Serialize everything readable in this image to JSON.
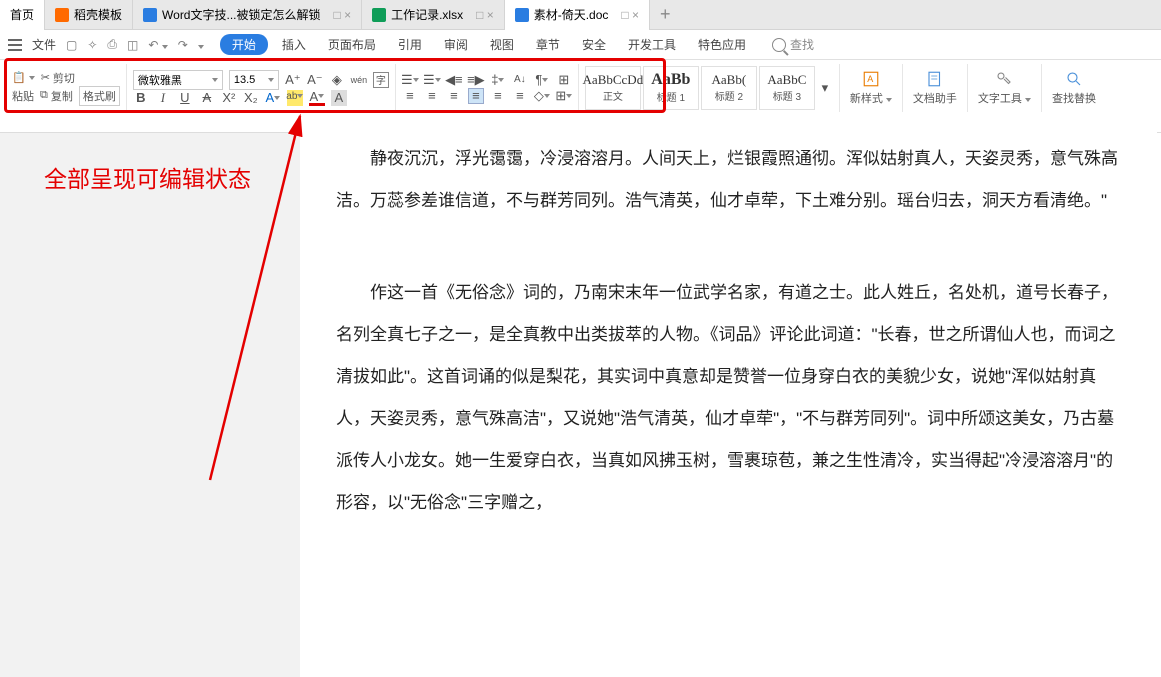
{
  "tabs": [
    {
      "label": "首页",
      "icon": "#2a7de1",
      "active": true
    },
    {
      "label": "稻壳模板",
      "icon": "#ff6a00"
    },
    {
      "label": "Word文字技...被锁定怎么解锁",
      "icon": "#2a7de1",
      "ctl": "□ ×"
    },
    {
      "label": "工作记录.xlsx",
      "icon": "#0f9d58",
      "ctl": "□ ×"
    },
    {
      "label": "素材-倚天.doc",
      "icon": "#2a7de1",
      "ctl": "□ ×"
    }
  ],
  "qat": {
    "file": "文件"
  },
  "menu": [
    "开始",
    "插入",
    "页面布局",
    "引用",
    "审阅",
    "视图",
    "章节",
    "安全",
    "开发工具",
    "特色应用"
  ],
  "search": "查找",
  "clipboard": {
    "paste": "粘贴",
    "cut": "剪切",
    "copy": "复制",
    "painter": "格式刷"
  },
  "font": {
    "name": "微软雅黑",
    "size": "13.5"
  },
  "icons": {
    "incfont": "A⁺",
    "decfont": "A⁻",
    "clearfmt": "◈",
    "phonetic": "wén",
    "charborder": "字",
    "bold": "B",
    "italic": "I",
    "underline": "U",
    "strike": "A",
    "sup": "X²",
    "sub": "X₂",
    "textfx": "A",
    "highlight": "ab",
    "fontcolor": "A",
    "bgcolor": "A"
  },
  "para": {
    "bullets": "≡",
    "numbers": "≡",
    "indent_dec": "≡",
    "indent_inc": "≡",
    "linespace": "‡",
    "sort": "↓A",
    "show": "¶",
    "tab": "⊞",
    "left": "≡",
    "center": "≡",
    "right": "≡",
    "justify": "≡",
    "dist": "≡",
    "distc": "≡",
    "shade": "◇",
    "border": "⊞"
  },
  "styles": [
    {
      "prev": "AaBbCcDd",
      "name": "正文"
    },
    {
      "prev": "AaBb",
      "name": "标题 1",
      "big": true
    },
    {
      "prev": "AaBb(",
      "name": "标题 2"
    },
    {
      "prev": "AaBbC",
      "name": "标题 3"
    }
  ],
  "right": [
    {
      "name": "新样式",
      "caret": true
    },
    {
      "name": "文档助手"
    },
    {
      "name": "文字工具",
      "caret": true
    },
    {
      "name": "查找替换"
    }
  ],
  "annotation": "全部呈现可编辑状态",
  "body": {
    "p1": "静夜沉沉，浮光霭霭，冷浸溶溶月。人间天上，烂银霞照通彻。浑似姑射真人，天姿灵秀，意气殊高洁。万蕊参差谁信道，不与群芳同列。浩气清英，仙才卓荦，下土难分别。瑶台归去，洞天方看清绝。\"",
    "p2": "作这一首《无俗念》词的，乃南宋末年一位武学名家，有道之士。此人姓丘，名处机，道号长春子，名列全真七子之一，是全真教中出类拔萃的人物。《词品》评论此词道：\"长春，世之所谓仙人也，而词之清拔如此\"。这首词诵的似是梨花，其实词中真意却是赞誉一位身穿白衣的美貌少女，说她\"浑似姑射真人，天姿灵秀，意气殊高洁\"，又说她\"浩气清英，仙才卓荦\"，\"不与群芳同列\"。词中所颂这美女，乃古墓派传人小龙女。她一生爱穿白衣，当真如风拂玉树，雪裹琼苞，兼之生性清冷，实当得起\"冷浸溶溶月\"的形容，以\"无俗念\"三字赠之，"
  }
}
